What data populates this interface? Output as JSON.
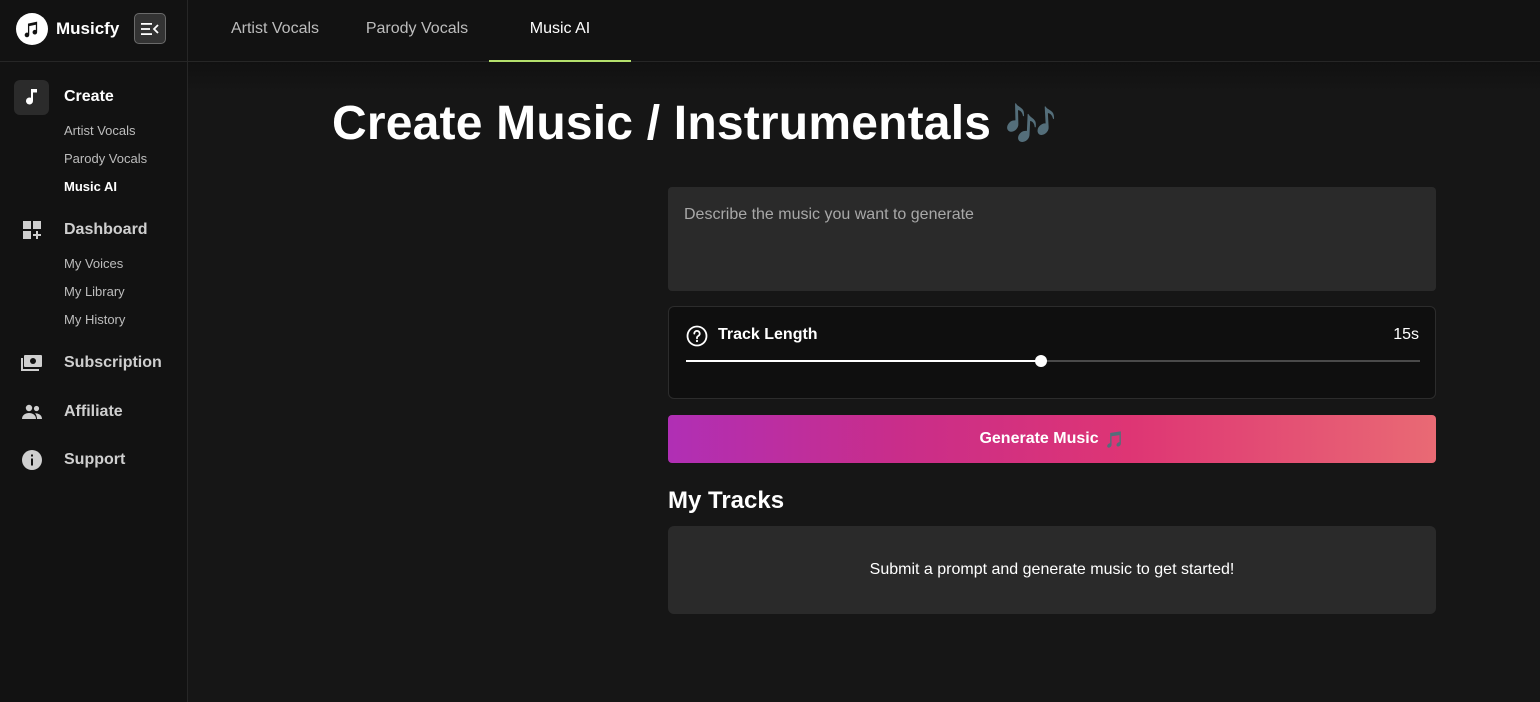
{
  "brand": {
    "name": "Musicfy"
  },
  "tabs": [
    {
      "label": "Artist Vocals",
      "active": false
    },
    {
      "label": "Parody Vocals",
      "active": false
    },
    {
      "label": "Music AI",
      "active": true
    }
  ],
  "sidebar": {
    "create": {
      "label": "Create",
      "items": [
        "Artist Vocals",
        "Parody Vocals",
        "Music AI"
      ]
    },
    "dashboard": {
      "label": "Dashboard",
      "items": [
        "My Voices",
        "My Library",
        "My History"
      ]
    },
    "subscription": {
      "label": "Subscription"
    },
    "affiliate": {
      "label": "Affiliate"
    },
    "support": {
      "label": "Support"
    }
  },
  "page": {
    "title": "Create Music / Instrumentals",
    "title_emoji": "🎶"
  },
  "prompt": {
    "placeholder": "Describe the music you want to generate",
    "value": ""
  },
  "track_length": {
    "label": "Track Length",
    "value": "15s",
    "fraction": 0.483
  },
  "generate": {
    "label": "Generate Music",
    "emoji": "🎵"
  },
  "tracks": {
    "title": "My Tracks",
    "empty_message": "Submit a prompt and generate music to get started!"
  },
  "colors": {
    "accent_underline": "#b4e06c",
    "gradient_start": "#b02fb5",
    "gradient_end": "#e96a74"
  }
}
